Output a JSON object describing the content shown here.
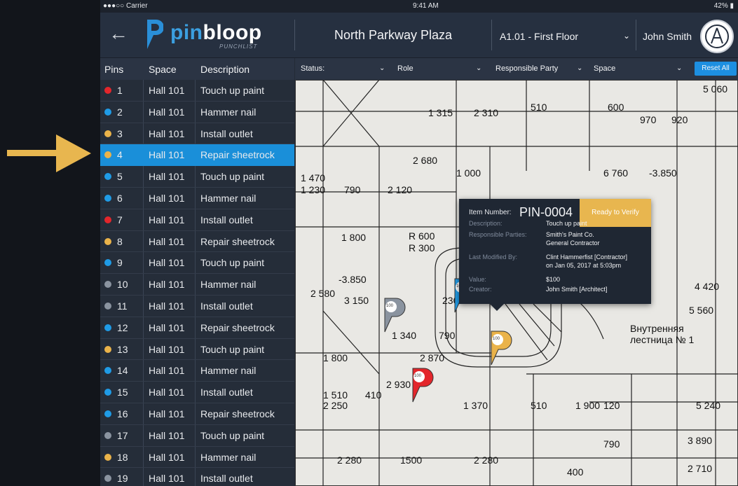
{
  "statusbar": {
    "carrier": "●●●○○ Carrier",
    "time": "9:41 AM",
    "battery": "42%"
  },
  "app": {
    "logo_part1": "pin",
    "logo_part2": "bloop",
    "logo_sub": "PUNCHLIST",
    "project": "North Parkway Plaza",
    "sheet": "A1.01 - First Floor",
    "user": "John Smith"
  },
  "filters": {
    "status": "Status:",
    "role": "Role",
    "responsible": "Responsible Party",
    "space": "Space",
    "reset": "Reset All"
  },
  "table": {
    "headers": {
      "pins": "Pins",
      "space": "Space",
      "description": "Description"
    },
    "rows": [
      {
        "num": "1",
        "space": "Hall 101",
        "desc": "Touch up paint",
        "color": "#e3262b"
      },
      {
        "num": "2",
        "space": "Hall 101",
        "desc": "Hammer nail",
        "color": "#1f9be6"
      },
      {
        "num": "3",
        "space": "Hall 101",
        "desc": "Install outlet",
        "color": "#eab34a"
      },
      {
        "num": "4",
        "space": "Hall 101",
        "desc": "Repair sheetrock",
        "color": "#eab34a"
      },
      {
        "num": "5",
        "space": "Hall 101",
        "desc": "Touch up paint",
        "color": "#1f9be6"
      },
      {
        "num": "6",
        "space": "Hall 101",
        "desc": "Hammer nail",
        "color": "#1f9be6"
      },
      {
        "num": "7",
        "space": "Hall 101",
        "desc": "Install outlet",
        "color": "#e3262b"
      },
      {
        "num": "8",
        "space": "Hall 101",
        "desc": "Repair sheetrock",
        "color": "#eab34a"
      },
      {
        "num": "9",
        "space": "Hall 101",
        "desc": "Touch up paint",
        "color": "#1f9be6"
      },
      {
        "num": "10",
        "space": "Hall 101",
        "desc": "Hammer nail",
        "color": "#8a939f"
      },
      {
        "num": "11",
        "space": "Hall 101",
        "desc": "Install outlet",
        "color": "#8a939f"
      },
      {
        "num": "12",
        "space": "Hall 101",
        "desc": "Repair sheetrock",
        "color": "#1f9be6"
      },
      {
        "num": "13",
        "space": "Hall 101",
        "desc": "Touch up paint",
        "color": "#eab34a"
      },
      {
        "num": "14",
        "space": "Hall 101",
        "desc": "Hammer nail",
        "color": "#1f9be6"
      },
      {
        "num": "15",
        "space": "Hall 101",
        "desc": "Install outlet",
        "color": "#1f9be6"
      },
      {
        "num": "16",
        "space": "Hall 101",
        "desc": "Repair sheetrock",
        "color": "#1f9be6"
      },
      {
        "num": "17",
        "space": "Hall 101",
        "desc": "Touch up paint",
        "color": "#8a939f"
      },
      {
        "num": "18",
        "space": "Hall 101",
        "desc": "Hammer nail",
        "color": "#eab34a"
      },
      {
        "num": "19",
        "space": "Hall 101",
        "desc": "Install outlet",
        "color": "#8a939f"
      }
    ],
    "selected_index": 3
  },
  "plan": {
    "dims": [
      "5 060",
      "1 315",
      "2 310",
      "510",
      "600",
      "970",
      "920",
      "2 680",
      "1 470",
      "1 000",
      "6 760",
      "-3.850",
      "1 230",
      "790",
      "2 120",
      "1 800",
      "R 600",
      "R 300",
      "-3.850",
      "2 580",
      "3 150",
      "230",
      "1 340",
      "790",
      "2 870",
      "1 800",
      "2 930",
      "1 510",
      "410",
      "2 250",
      "1 370",
      "510",
      "1 900",
      "120",
      "5 240",
      "2 280",
      "1500",
      "2 280",
      "790",
      "3 890",
      "2 710",
      "400",
      "5 560",
      "4 420",
      "Внутренняя",
      "лестница № 1"
    ],
    "pin_label": "100"
  },
  "popup": {
    "item_label": "Item Number:",
    "item_value": "PIN-0004",
    "status_button": "Ready to Verify",
    "fields": [
      {
        "label": "Description:",
        "value": "Touch up paint"
      },
      {
        "label": "Responsible Parties:",
        "value": "Smith's Paint Co."
      },
      {
        "label": "",
        "value": "General Contractor"
      },
      {
        "label": "Last Modified By:",
        "value": "Clint Hammerfist [Contractor]"
      },
      {
        "label": "",
        "value": "on Jan 05, 2017 at 5:03pm"
      },
      {
        "label": "Value:",
        "value": "$100"
      },
      {
        "label": "Creator:",
        "value": "John Smith [Architect]"
      }
    ]
  },
  "colors": {
    "accent": "#1a8fd9",
    "pointer_arrow": "#e8b64f",
    "status_button": "#e8b64f"
  }
}
